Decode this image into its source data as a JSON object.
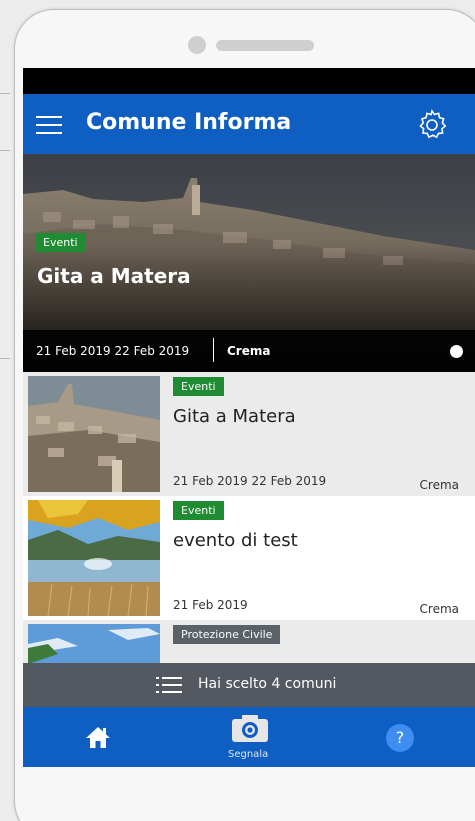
{
  "app": {
    "title": "Comune Informa"
  },
  "hero": {
    "tag": "Eventi",
    "title": "Gita a Matera",
    "dates": "21 Feb 2019 22 Feb 2019",
    "location": "Crema"
  },
  "list": [
    {
      "tag": "Eventi",
      "tag_color": "#1f8c33",
      "title": "Gita a Matera",
      "dates": "21 Feb 2019 22 Feb 2019",
      "location": "Crema"
    },
    {
      "tag": "Eventi",
      "tag_color": "#1f8c33",
      "title": "evento di test",
      "dates": "21 Feb 2019",
      "location": "Crema"
    },
    {
      "tag": "Protezione Civile",
      "tag_color": "#5a6168",
      "title": "",
      "dates": "",
      "location": ""
    }
  ],
  "comuni_bar": {
    "label": "Hai scelto 4 comuni"
  },
  "bottom_nav": {
    "home_icon": "home-icon",
    "camera_label": "Segnala",
    "help_symbol": "?"
  },
  "colors": {
    "primary": "#0f5fc2",
    "events_tag": "#1f8c33",
    "protezione_tag": "#5a6168"
  }
}
